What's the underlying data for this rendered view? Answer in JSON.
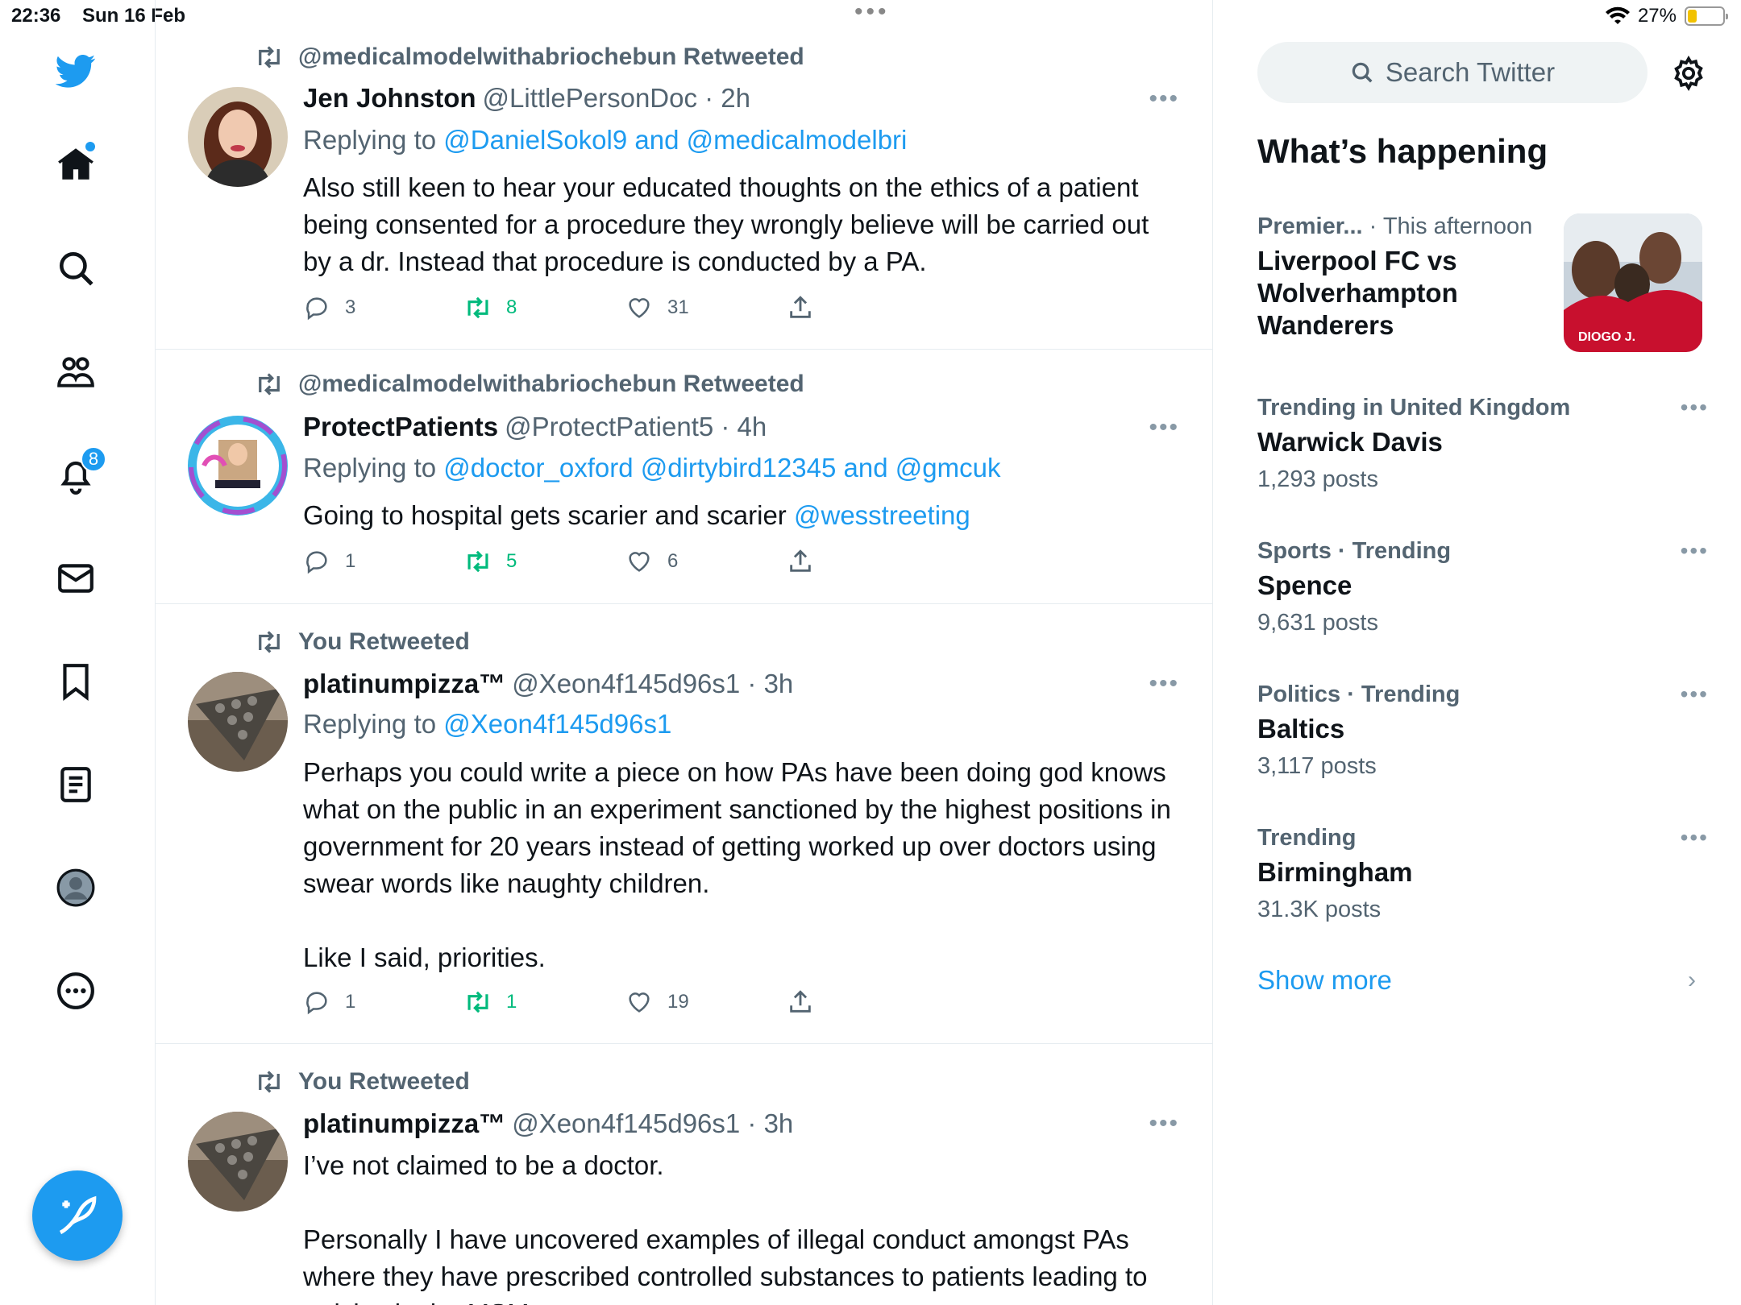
{
  "status": {
    "time": "22:36",
    "date": "Sun 16 Feb",
    "battery": "27%",
    "battery_level": 0.27
  },
  "nav": {
    "icons": [
      "twitter-bird-icon",
      "home-icon",
      "search-icon",
      "communities-icon",
      "notifications-icon",
      "messages-icon",
      "bookmarks-icon",
      "lists-icon",
      "profile-icon",
      "more-icon"
    ],
    "notifications_badge": "8"
  },
  "tweets": [
    {
      "context": "@medicalmodelwithabriochebun Retweeted",
      "name": "Jen Johnston",
      "handle": "@LittlePersonDoc · 2h",
      "reply_prefix": "Replying to ",
      "reply_to": "@DanielSokol9 and @medicalmodelbri",
      "lines": [
        "Also still keen to hear your educated thoughts on the ethics of a patient being consented for a procedure they wrongly believe will be carried out by a dr. Instead that procedure is conducted by a PA."
      ],
      "replies": "3",
      "retweets": "8",
      "likes": "31"
    },
    {
      "context": "@medicalmodelwithabriochebun Retweeted",
      "name": "ProtectPatients",
      "handle": "@ProtectPatient5 · 4h",
      "reply_prefix": "Replying to ",
      "reply_to": "@doctor_oxford @dirtybird12345 and @gmcuk",
      "text": "Going to hospital gets scarier and scarier ",
      "text_mention": "@wesstreeting",
      "replies": "1",
      "retweets": "5",
      "likes": "6"
    },
    {
      "context": "You Retweeted",
      "name": "platinumpizza™",
      "handle": "@Xeon4f145d96s1 · 3h",
      "reply_prefix": "Replying to ",
      "reply_to": "@Xeon4f145d96s1",
      "para1": "Perhaps you could write a piece on how PAs have been doing god knows what on the public in an experiment sanctioned by the highest positions in government for 20 years instead of getting worked up over doctors using swear words like naughty children.",
      "para2": "Like I said, priorities.",
      "replies": "1",
      "retweets": "1",
      "likes": "19"
    },
    {
      "context": "You Retweeted",
      "name": "platinumpizza™",
      "handle": "@Xeon4f145d96s1 · 3h",
      "para1": "I’ve not claimed to be a doctor.",
      "para2": "Personally I have uncovered examples of illegal conduct amongst PAs where they have prescribed controlled substances to patients leading to articles in the MSM"
    }
  ],
  "right": {
    "search_placeholder": "Search Twitter",
    "heading": "What’s happening",
    "trends": [
      {
        "category": "Premier...",
        "when": " · This afternoon",
        "title": "Liverpool FC vs Wolverhampton Wanderers",
        "image_text": "DIOGO J."
      },
      {
        "meta": "Trending in United Kingdom",
        "title": "Warwick Davis",
        "count": "1,293 posts"
      },
      {
        "meta": "Sports · Trending",
        "title": "Spence",
        "count": "9,631 posts"
      },
      {
        "meta": "Politics · Trending",
        "title": "Baltics",
        "count": "3,117 posts"
      },
      {
        "meta": "Trending",
        "title": "Birmingham",
        "count": "31.3K posts"
      }
    ],
    "show_more": "Show more"
  },
  "colors": {
    "accent": "#1d9bf0",
    "retweet_green": "#00ba7c",
    "muted": "#536471"
  }
}
